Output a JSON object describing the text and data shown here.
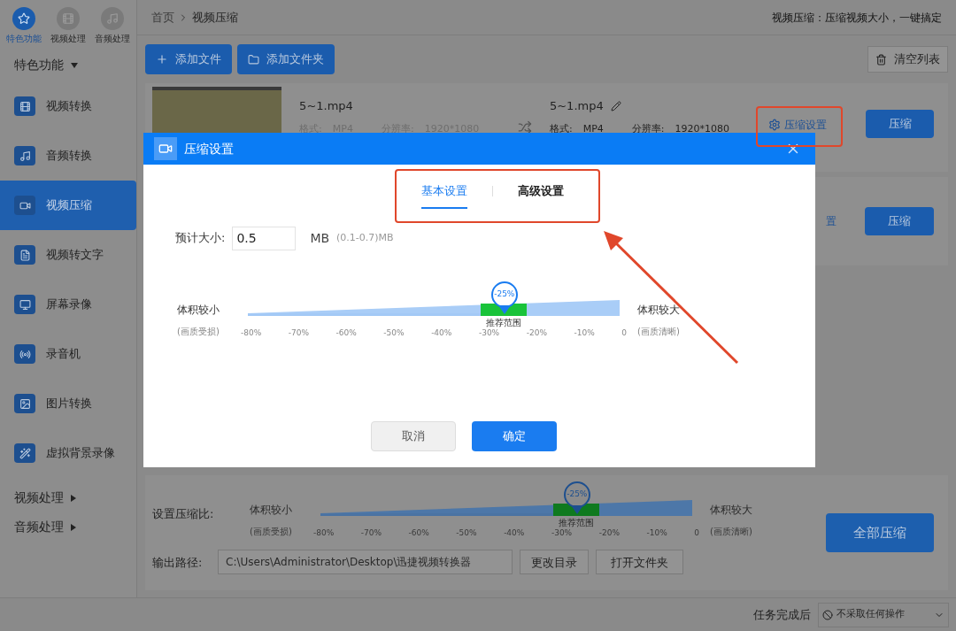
{
  "nav_tabs": [
    {
      "label": "特色功能",
      "selected": true
    },
    {
      "label": "视频处理",
      "selected": false
    },
    {
      "label": "音频处理",
      "selected": false
    }
  ],
  "sidebar": {
    "section": "特色功能",
    "items": [
      {
        "label": "视频转换",
        "selected": false
      },
      {
        "label": "音频转换",
        "selected": false
      },
      {
        "label": "视频压缩",
        "selected": true
      },
      {
        "label": "视频转文字",
        "selected": false
      },
      {
        "label": "屏幕录像",
        "selected": false
      },
      {
        "label": "录音机",
        "selected": false
      },
      {
        "label": "图片转换",
        "selected": false
      },
      {
        "label": "虚拟背景录像",
        "selected": false
      }
    ],
    "groups": [
      "视频处理",
      "音频处理"
    ]
  },
  "breadcrumb": [
    "首页",
    "视频压缩"
  ],
  "tagline": "视频压缩：压缩视频大小，一键搞定",
  "toolbar": {
    "add_file": "添加文件",
    "add_folder": "添加文件夹",
    "clear": "清空列表"
  },
  "files": [
    {
      "name": "5~1.mp4",
      "format_label": "格式:",
      "format": "MP4",
      "resolution_label": "分辨率:",
      "resolution": "1920*1080",
      "output_name": "5~1.mp4",
      "out_format_label": "格式:",
      "out_format": "MP4",
      "out_resolution_label": "分辨率:",
      "out_resolution": "1920*1080",
      "settings": "压缩设置",
      "action": "压缩"
    },
    {
      "settings": "置",
      "action": "压缩"
    }
  ],
  "bottom": {
    "ratio_label": "设置压缩比:",
    "slider": {
      "left_label": "体积较小",
      "left_note": "(画质受损)",
      "right_label": "体积较大",
      "right_note": "(画质清晰)",
      "marker": "-25%",
      "range_label": "推荐范围",
      "level": 0.69,
      "ticks": [
        "-80%",
        "-70%",
        "-60%",
        "-50%",
        "-40%",
        "-30%",
        "-20%",
        "-10%",
        "0"
      ]
    },
    "path_label": "输出路径:",
    "path": "C:\\Users\\Administrator\\Desktop\\迅捷视频转换器",
    "change_dir": "更改目录",
    "open_folder": "打开文件夹",
    "compress_all": "全部压缩"
  },
  "status_bar": {
    "after_label": "任务完成后",
    "action": "不采取任何操作"
  },
  "dialog": {
    "title": "压缩设置",
    "tabs": [
      {
        "label": "基本设置",
        "selected": true
      },
      {
        "label": "高级设置",
        "selected": false
      }
    ],
    "size_label": "预计大小:",
    "size_value": "0.5",
    "unit": "MB",
    "range": "(0.1-0.7)MB",
    "slider": {
      "left_label": "体积较小",
      "left_note": "(画质受损)",
      "right_label": "体积较大",
      "right_note": "(画质清晰)",
      "marker": "-25%",
      "range_label": "推荐范围",
      "level": 0.69,
      "ticks": [
        "-80%",
        "-70%",
        "-60%",
        "-50%",
        "-40%",
        "-30%",
        "-20%",
        "-10%",
        "0"
      ]
    },
    "cancel": "取消",
    "ok": "确定"
  }
}
